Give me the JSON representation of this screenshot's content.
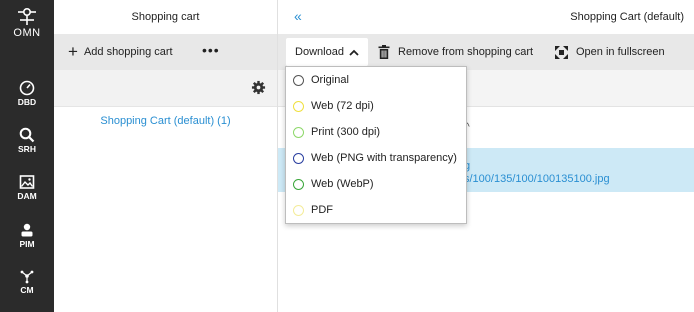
{
  "rail": {
    "logo_text": "OMN",
    "items": [
      {
        "label": "DBD",
        "icon": "dashboard-icon"
      },
      {
        "label": "SRH",
        "icon": "search-icon"
      },
      {
        "label": "DAM",
        "icon": "image-icon"
      },
      {
        "label": "PIM",
        "icon": "product-icon"
      },
      {
        "label": "CM",
        "icon": "network-icon"
      }
    ]
  },
  "left_panel": {
    "title": "Shopping cart",
    "add_label": "Add shopping cart",
    "more_label": "•••",
    "cart_item": "Shopping Cart (default) (1)"
  },
  "right_panel": {
    "back_label": "«",
    "title": "Shopping Cart (default)",
    "toolbar": {
      "download_label": "Download",
      "remove_label": "Remove from shopping cart",
      "fullscreen_label": "Open in fullscreen"
    },
    "row": {
      "line1": "g",
      "line2": "s/100/135/100/100135100.jpg"
    }
  },
  "download_menu": {
    "options": [
      {
        "label": "Original",
        "color": "#888888"
      },
      {
        "label": "Web (72 dpi)",
        "color": "#f0e040"
      },
      {
        "label": "Print (300 dpi)",
        "color": "#8ed86a"
      },
      {
        "label": "Web (PNG with transparency)",
        "color": "#2a3fa0"
      },
      {
        "label": "Web (WebP)",
        "color": "#3aa63a"
      },
      {
        "label": "PDF",
        "color": "#f4ec9a"
      }
    ]
  },
  "colors": {
    "accent": "#2a8fd2",
    "rail_bg": "#2b2b2b",
    "selected_row": "#cde9f6"
  }
}
